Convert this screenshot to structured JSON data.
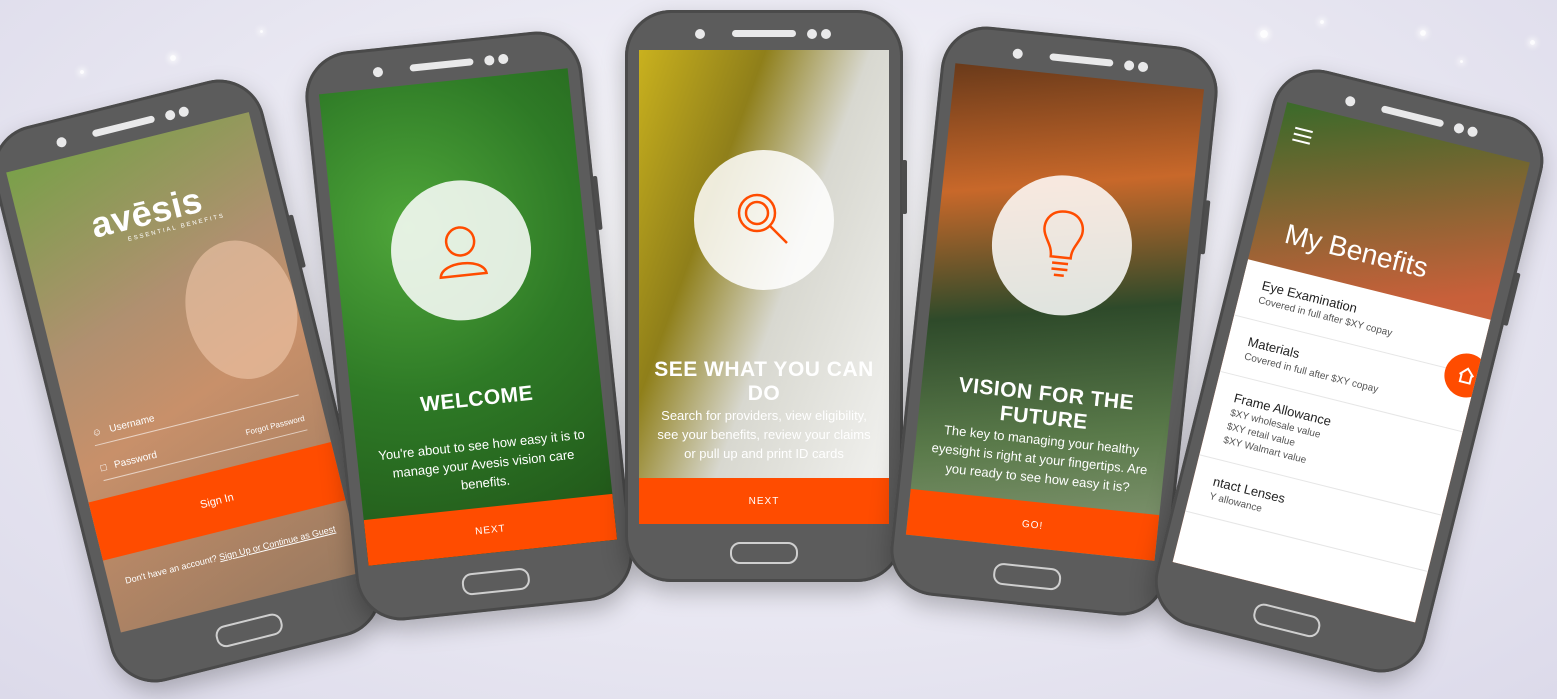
{
  "colors": {
    "accent": "#ff4c00",
    "phone_body": "#5c5c5c"
  },
  "phone1": {
    "logo": "avēsis",
    "logo_sub": "ESSENTIAL BENEFITS",
    "username_placeholder": "Username",
    "password_placeholder": "Password",
    "forgot_password": "Forgot Password",
    "sign_in": "Sign In",
    "no_account": "Don't have an account?",
    "signup_link": "Sign Up or Continue as Guest"
  },
  "phone2": {
    "icon": "user-icon",
    "title": "WELCOME",
    "body": "You're about to see how easy it is to manage your Avesis vision care benefits.",
    "button": "NEXT"
  },
  "phone3": {
    "icon": "search-icon",
    "title": "SEE WHAT YOU CAN DO",
    "body": "Search for providers, view eligibility, see your benefits, review your claims or pull up and print ID cards",
    "button": "NEXT"
  },
  "phone4": {
    "icon": "lightbulb-icon",
    "title": "VISION FOR THE FUTURE",
    "body": "The key to managing your healthy eyesight is right at your fingertips. Are you ready to see how easy it is?",
    "button": "GO!"
  },
  "phone5": {
    "title": "My Benefits",
    "fab_icon": "home-icon",
    "items": [
      {
        "name": "Eye Examination",
        "desc": "Covered in full after $XY copay"
      },
      {
        "name": "Materials",
        "desc": "Covered in full after $XY copay"
      },
      {
        "name": "Frame Allowance",
        "desc": "$XY wholesale value\n$XY retail value\n$XY Walmart value"
      },
      {
        "name": "ntact Lenses",
        "desc": "Y allowance"
      }
    ]
  }
}
